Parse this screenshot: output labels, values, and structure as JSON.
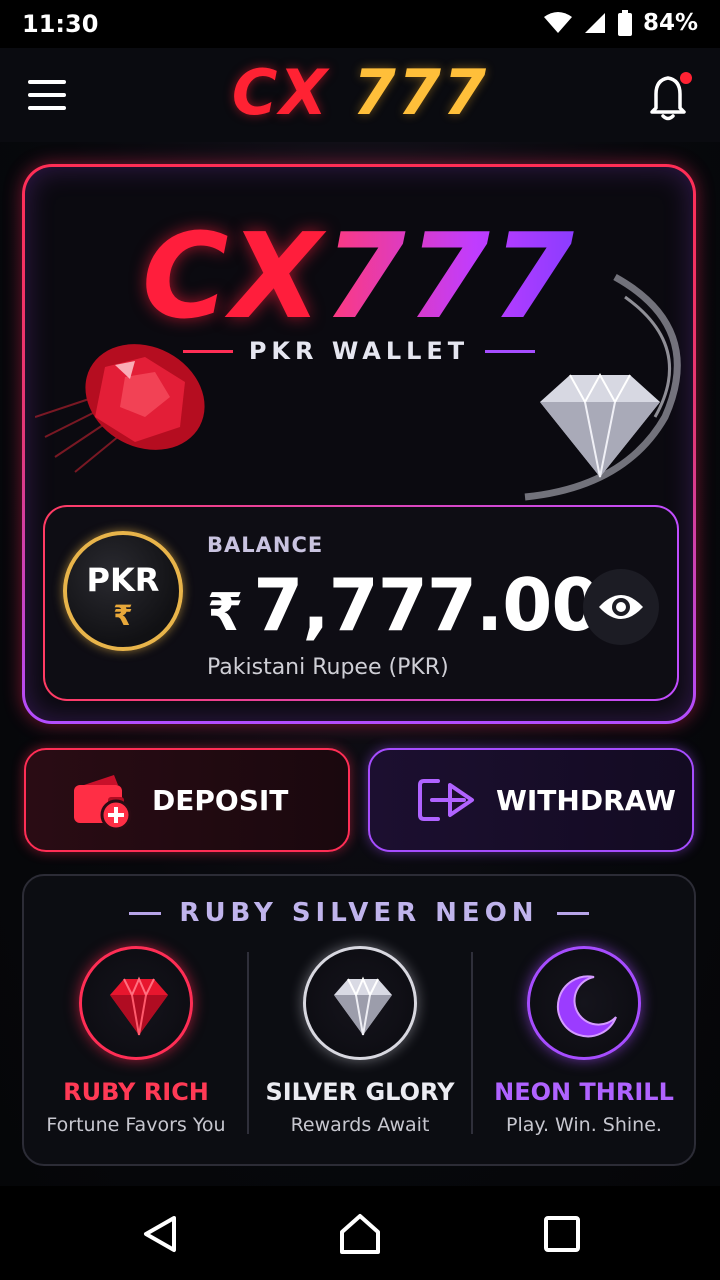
{
  "status_bar": {
    "time": "11:30",
    "battery": "84%",
    "icons": [
      "wifi-icon",
      "signal-icon",
      "battery-icon"
    ]
  },
  "app_bar": {
    "brand_prefix": "CX",
    "brand_number": "777",
    "menu_icon": "hamburger-menu-icon",
    "notification_icon": "bell-icon",
    "has_unread_notification": true
  },
  "wallet": {
    "logo_prefix": "CX",
    "logo_number": "777",
    "subtitle": "PKR WALLET",
    "coin_label": "PKR",
    "coin_symbol": "₹",
    "balance_label": "BALANCE",
    "currency_symbol": "₹",
    "balance": "7,777.00",
    "currency_name": "Pakistani Rupee (PKR)",
    "visibility_icon": "eye-icon"
  },
  "actions": {
    "deposit_label": "DEPOSIT",
    "deposit_icon": "wallet-plus-icon",
    "withdraw_label": "WITHDRAW",
    "withdraw_icon": "arrow-out-icon"
  },
  "tiers": {
    "title": "RUBY SILVER NEON",
    "items": [
      {
        "name": "RUBY RICH",
        "tagline": "Fortune Favors You",
        "icon": "ruby-gem-icon",
        "color": "#ff3a55"
      },
      {
        "name": "SILVER GLORY",
        "tagline": "Rewards Await",
        "icon": "diamond-icon",
        "color": "#ececf2"
      },
      {
        "name": "NEON THRILL",
        "tagline": "Play. Win. Shine.",
        "icon": "crescent-moon-icon",
        "color": "#b063ff"
      }
    ]
  },
  "nav_bar": {
    "buttons": [
      "back-icon",
      "home-icon",
      "recents-icon"
    ]
  },
  "colors": {
    "ruby": "#ff2e55",
    "neon_purple": "#a64dff",
    "gold": "#e8b44a",
    "brand_gold": "#ffbf3a"
  }
}
